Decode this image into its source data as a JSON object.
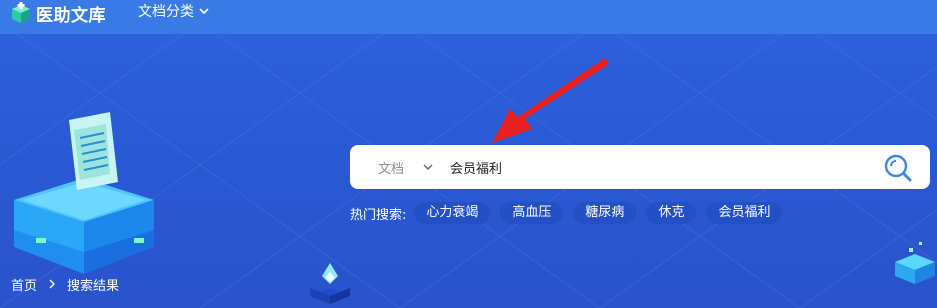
{
  "header": {
    "logo_text": "医助文库",
    "nav": {
      "doc_category_label": "文档分类"
    }
  },
  "search": {
    "type_label": "文档",
    "query": "会员福利",
    "placeholder": ""
  },
  "hot_searches": {
    "label": "热门搜索:",
    "tags": [
      "心力衰竭",
      "高血压",
      "糖尿病",
      "休克",
      "会员福利"
    ]
  },
  "breadcrumb": {
    "home": "首页",
    "current": "搜索结果"
  },
  "colors": {
    "topbar": "#3a7ae6",
    "banner": "#2a58d3",
    "tag_bg": "#2450c5",
    "annotation_arrow": "#e8201f"
  },
  "icons": [
    "logo-cube-icon",
    "chevron-down-icon",
    "search-icon",
    "chevron-right-icon"
  ]
}
